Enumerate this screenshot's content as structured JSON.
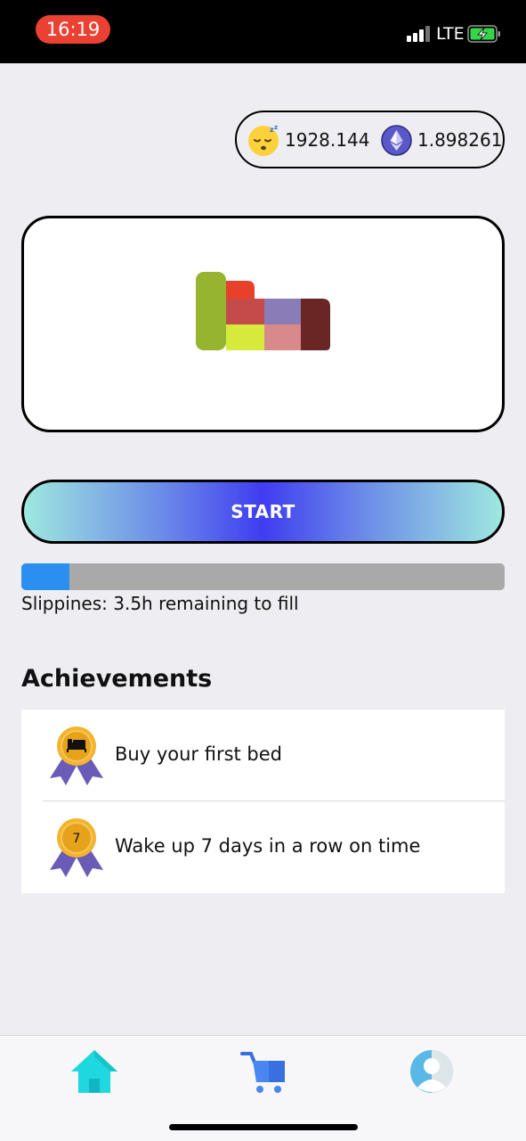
{
  "status_bar": {
    "time": "16:19",
    "network": "LTE"
  },
  "balances": {
    "sleep_tokens": "1928.144",
    "eth": "1.898261"
  },
  "bed": {
    "image_icon": "bed-icon"
  },
  "actions": {
    "start_label": "START"
  },
  "slippines": {
    "fill_fraction": 0.1,
    "text": "Slippines: 3.5h remaining to fill"
  },
  "achievements": {
    "title": "Achievements",
    "items": [
      {
        "label": "Buy your first bed",
        "badge_icon": "bed-icon"
      },
      {
        "label": "Wake up 7 days in a row on time",
        "badge_text": "7"
      }
    ]
  },
  "tabs": [
    {
      "name": "home",
      "icon": "home-icon",
      "active": true
    },
    {
      "name": "shop",
      "icon": "cart-icon"
    },
    {
      "name": "profile",
      "icon": "user-icon"
    }
  ],
  "colors": {
    "accent_blue": "#2b8ff0",
    "start_gradient_center": "#3f3df0",
    "start_gradient_edge": "#9fe8df",
    "home_tab": "#1fd7df",
    "medal_gold": "#f2b430",
    "medal_ribbon": "#6a5bb6"
  }
}
